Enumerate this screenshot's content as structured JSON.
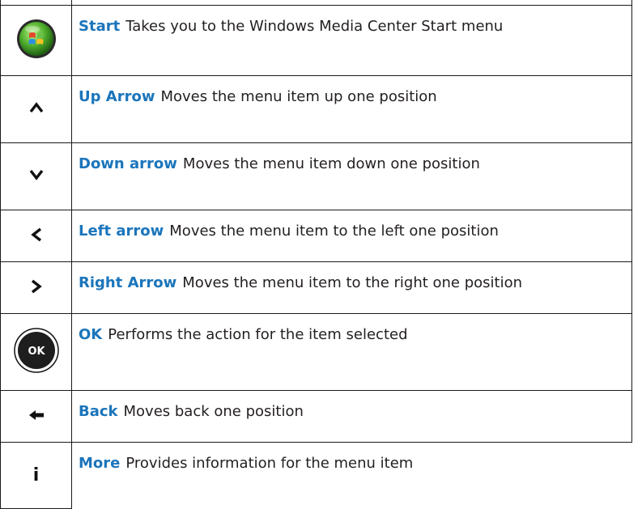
{
  "rows": [
    {
      "icon": "windows-start-icon",
      "term": "Start",
      "description": "Takes you to the Windows Media Center Start menu"
    },
    {
      "icon": "up-arrow-icon",
      "term": "Up Arrow",
      "description": "Moves the menu item up one position"
    },
    {
      "icon": "down-arrow-icon",
      "term": "Down arrow",
      "description": "Moves the menu item down one position"
    },
    {
      "icon": "left-arrow-icon",
      "term": "Left arrow",
      "description": "Moves the menu item to the left one position"
    },
    {
      "icon": "right-arrow-icon",
      "term": "Right Arrow",
      "description": "Moves the menu item to the right one position"
    },
    {
      "icon": "ok-button-icon",
      "icon_text": "OK",
      "term": "OK",
      "description": "Performs the action for the item selected"
    },
    {
      "icon": "back-arrow-icon",
      "term": "Back",
      "description": "Moves back one position"
    },
    {
      "icon": "info-icon",
      "icon_text": "i",
      "term": "More",
      "description": "Provides information for the menu item"
    }
  ],
  "colors": {
    "term": "#1b75bb",
    "text": "#231f20",
    "border": "#1a1a1a"
  }
}
